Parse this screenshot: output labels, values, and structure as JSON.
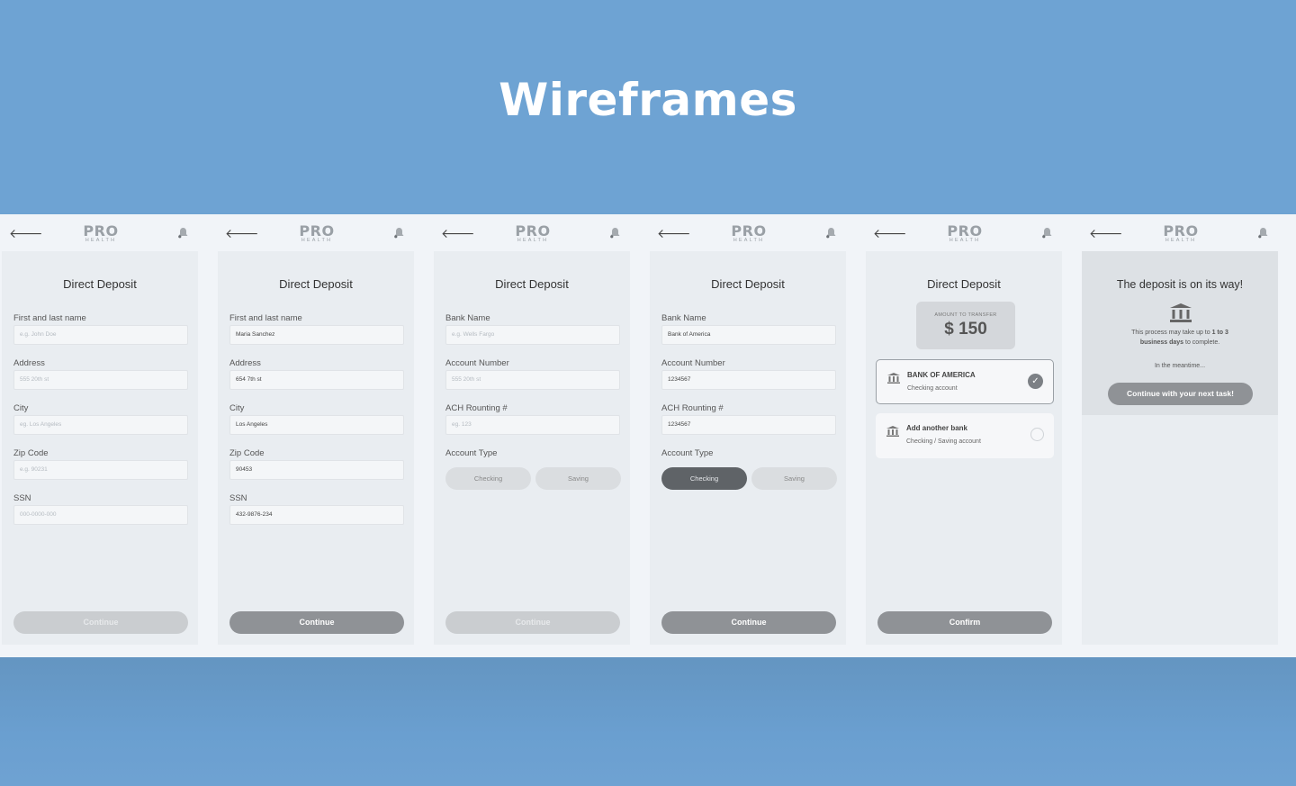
{
  "page_title": "Wireframes",
  "app": {
    "logo_main": "PRO",
    "logo_sub": "HEALTH",
    "back_icon": "arrow-left-icon",
    "bell_icon": "bell-icon"
  },
  "screen1": {
    "heading": "Direct Deposit",
    "fields": [
      {
        "label": "First and last name",
        "value": "e.g. John Doe"
      },
      {
        "label": "Address",
        "value": "555 20th st"
      },
      {
        "label": "City",
        "value": "eg. Los Angeles"
      },
      {
        "label": "Zip Code",
        "value": "e.g. 90231"
      },
      {
        "label": "SSN",
        "value": "000-0000-000"
      }
    ],
    "button": "Continue"
  },
  "screen2": {
    "heading": "Direct Deposit",
    "fields": [
      {
        "label": "First and last name",
        "value": "Maria Sanchez"
      },
      {
        "label": "Address",
        "value": "654 7th st"
      },
      {
        "label": "City",
        "value": "Los Angeles"
      },
      {
        "label": "Zip Code",
        "value": "90453"
      },
      {
        "label": "SSN",
        "value": "432-9876-234"
      }
    ],
    "button": "Continue"
  },
  "screen3": {
    "heading": "Direct Deposit",
    "fields": [
      {
        "label": "Bank Name",
        "value": "e.g. Wells Fargo"
      },
      {
        "label": "Account Number",
        "value": "555 20th st"
      },
      {
        "label": "ACH Rounting #",
        "value": "eg. 123"
      }
    ],
    "account_type_label": "Account Type",
    "toggle_checking": "Checking",
    "toggle_saving": "Saving",
    "button": "Continue"
  },
  "screen4": {
    "heading": "Direct Deposit",
    "fields": [
      {
        "label": "Bank Name",
        "value": "Bank of America"
      },
      {
        "label": "Account Number",
        "value": "1234567"
      },
      {
        "label": "ACH Rounting #",
        "value": "1234567"
      }
    ],
    "account_type_label": "Account Type",
    "toggle_checking": "Checking",
    "toggle_saving": "Saving",
    "button": "Continue"
  },
  "screen5": {
    "heading": "Direct Deposit",
    "amount_label": "AMOUNT TO TRANSFER",
    "amount": "$ 150",
    "bank1_name": "BANK OF AMERICA",
    "bank1_type": "Checking account",
    "bank2_name": "Add another bank",
    "bank2_type": "Checking / Saving account",
    "button": "Confirm"
  },
  "screen6": {
    "title": "The deposit is on its way!",
    "process_pre": "This process may take up to ",
    "process_bold1": "1 to 3",
    "process_bold2": "business days",
    "process_post": " to complete.",
    "meantime": "In the meantime...",
    "button": "Continue with your next task!"
  }
}
